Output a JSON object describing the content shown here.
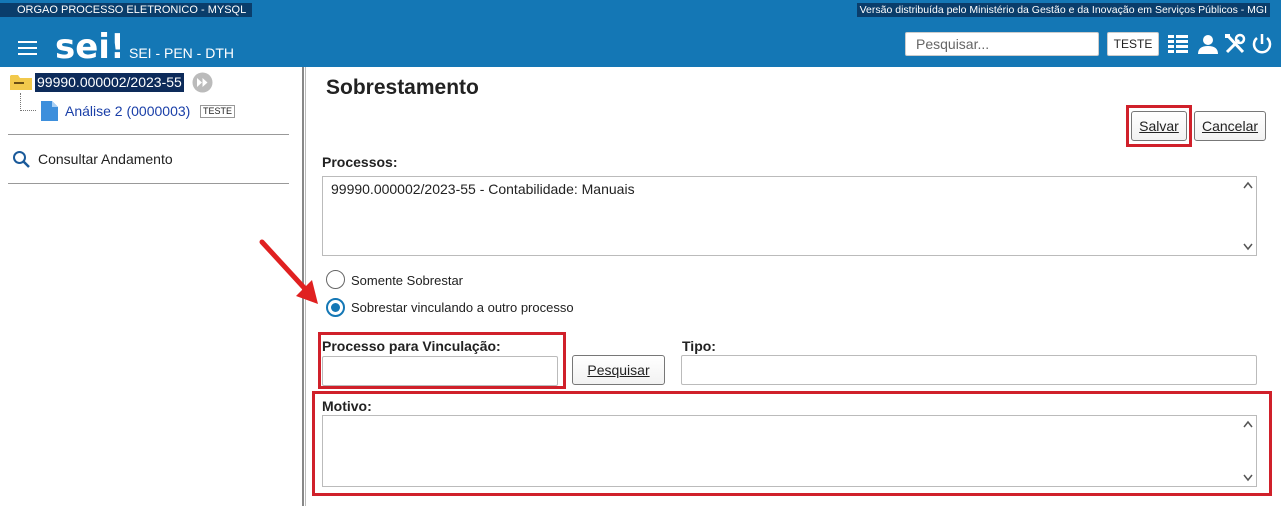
{
  "header": {
    "org_name": "ORGAO PROCESSO ELETRONICO - MYSQL",
    "version_note": "Versão distribuída pelo Ministério da Gestão e da Inovação em Serviços Públicos - MGI",
    "logo_text": "sei!",
    "system_name": "SEI - PEN - DTH",
    "search_placeholder": "Pesquisar...",
    "unit_label": "TESTE",
    "icons": [
      "menu-icon",
      "control-panel-icon",
      "user-icon",
      "tools-icon",
      "power-icon"
    ]
  },
  "tree": {
    "process_number": "99990.000002/2023-55",
    "document_label": "Análise 2 (0000003)",
    "document_tag": "TESTE",
    "consult_label": "Consultar Andamento"
  },
  "form": {
    "title": "Sobrestamento",
    "save_label": "Salvar",
    "cancel_label": "Cancelar",
    "processos_label": "Processos:",
    "processos_value": "99990.000002/2023-55 - Contabilidade: Manuais",
    "radio_options": [
      {
        "label": "Somente Sobrestar",
        "checked": false
      },
      {
        "label": "Sobrestar vinculando a outro processo",
        "checked": true
      }
    ],
    "vinculacao_label": "Processo para Vinculação:",
    "vinculacao_value": "",
    "search_button_label": "Pesquisar",
    "tipo_label": "Tipo:",
    "tipo_value": "",
    "motivo_label": "Motivo:",
    "motivo_value": ""
  },
  "colors": {
    "header_bg": "#1477b5",
    "highlight_red": "#d0202a",
    "arrow_red": "#e02020"
  }
}
